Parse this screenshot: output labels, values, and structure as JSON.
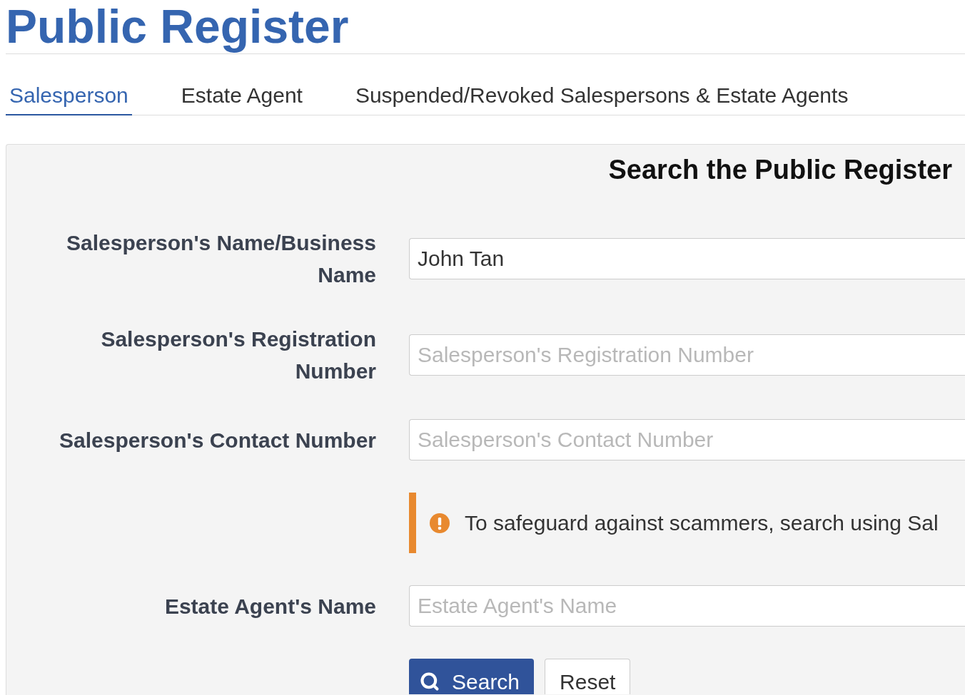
{
  "page": {
    "title": "Public Register"
  },
  "tabs": [
    {
      "label": "Salesperson",
      "selected": true
    },
    {
      "label": "Estate Agent",
      "selected": false
    },
    {
      "label": "Suspended/Revoked Salespersons & Estate Agents",
      "selected": false
    }
  ],
  "search_panel": {
    "heading": "Search the Public Register",
    "fields": [
      {
        "kind": "input",
        "label": "Salesperson's Name/Business Name",
        "value": "John Tan"
      },
      {
        "kind": "input",
        "label": "Salesperson's Registration Number",
        "placeholder": "Salesperson's Registration Number"
      },
      {
        "kind": "input",
        "label": "Salesperson's Contact Number",
        "placeholder": "Salesperson's Contact Number"
      },
      {
        "kind": "notice",
        "text": "To safeguard against scammers, search using Sal"
      },
      {
        "kind": "input",
        "label": "Estate Agent's Name",
        "placeholder": "Estate Agent's Name"
      }
    ],
    "buttons": [
      {
        "kind": "primary",
        "label": "Search"
      },
      {
        "kind": "secondary",
        "label": "Reset"
      }
    ]
  }
}
